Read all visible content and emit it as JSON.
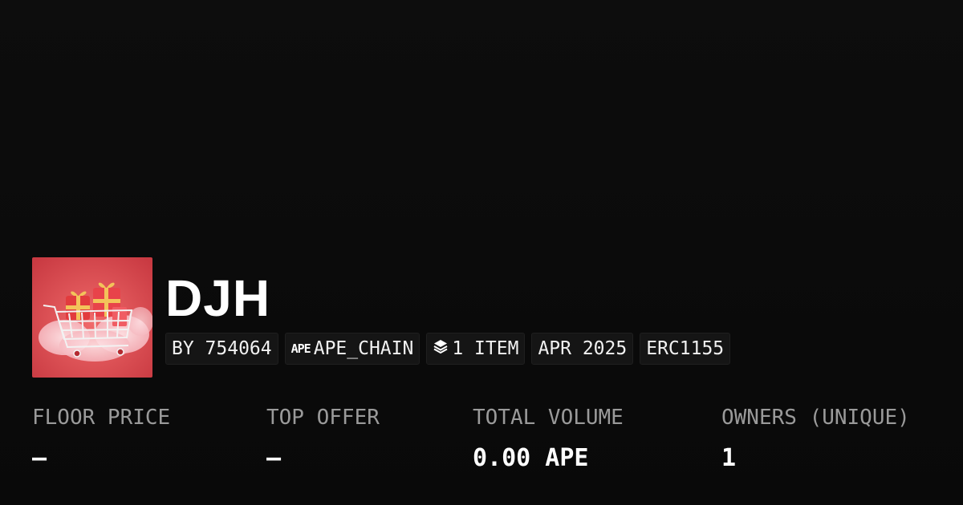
{
  "collection": {
    "name": "DJH",
    "avatar_icon": "shopping-cart-with-gifts-image"
  },
  "tags": {
    "creator": "BY 754064",
    "chain_icon": "APE",
    "chain": "APE_CHAIN",
    "items_icon": "layers-icon",
    "items": "1 ITEM",
    "date": "APR 2025",
    "standard": "ERC1155"
  },
  "stats": {
    "floor_price": {
      "label": "FLOOR PRICE",
      "value": "–"
    },
    "top_offer": {
      "label": "TOP OFFER",
      "value": "–"
    },
    "total_volume": {
      "label": "TOTAL VOLUME",
      "value": "0.00 APE"
    },
    "owners": {
      "label": "OWNERS (UNIQUE)",
      "value": "1"
    }
  },
  "colors": {
    "background": "#0b0b0b",
    "tag_background": "#151515",
    "text_primary": "#ffffff",
    "text_muted": "#9a9a9a",
    "avatar_background": "#d94a4f"
  }
}
